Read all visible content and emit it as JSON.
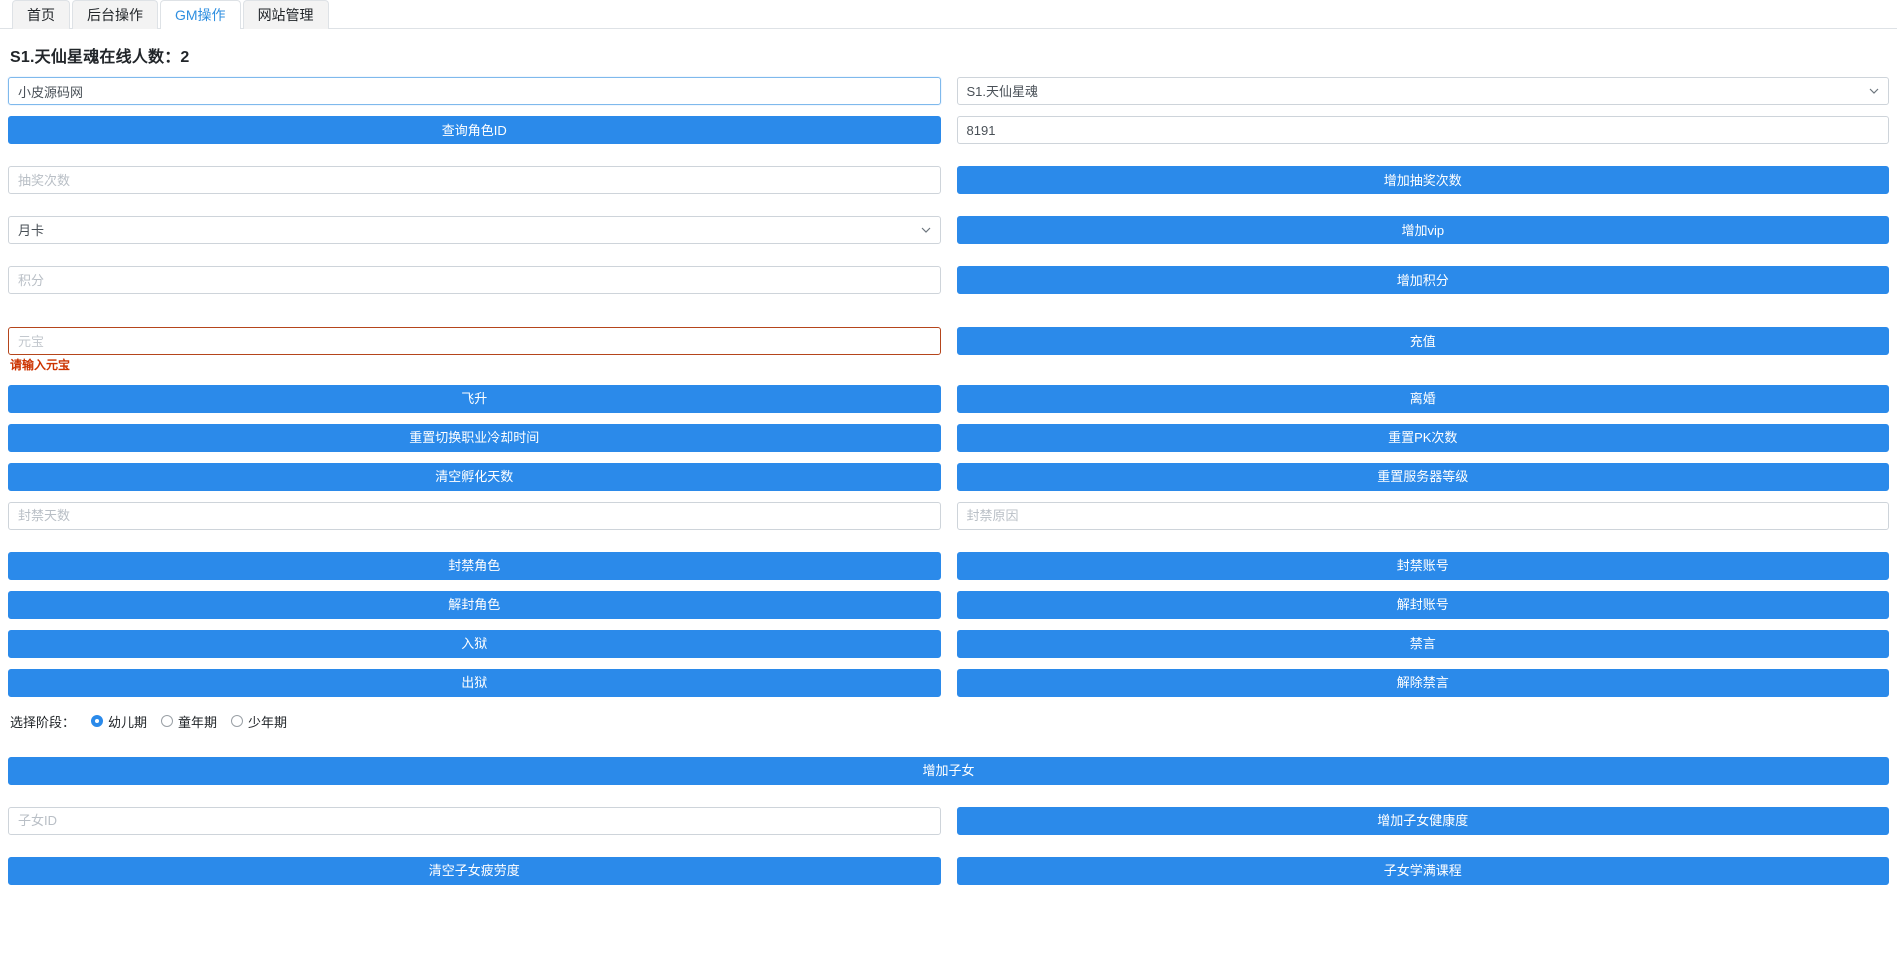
{
  "tabs": [
    {
      "label": "首页",
      "active": false
    },
    {
      "label": "后台操作",
      "active": false
    },
    {
      "label": "GM操作",
      "active": true
    },
    {
      "label": "网站管理",
      "active": false
    }
  ],
  "page_title": "S1.天仙星魂在线人数：2",
  "form": {
    "account_input": {
      "value": "小皮源码网",
      "placeholder": ""
    },
    "server_select": {
      "value": "S1.天仙星魂",
      "icon": "chevron-down-icon"
    },
    "query_role_id_button": "查询角色ID",
    "role_id_input": {
      "value": "8191",
      "placeholder": ""
    },
    "lottery_count_input": {
      "value": "",
      "placeholder": "抽奖次数"
    },
    "add_lottery_count_button": "增加抽奖次数",
    "vip_select": {
      "value": "月卡",
      "icon": "chevron-down-icon"
    },
    "add_vip_button": "增加vip",
    "points_input": {
      "value": "",
      "placeholder": "积分"
    },
    "add_points_button": "增加积分",
    "ingot_input": {
      "value": "",
      "placeholder": "元宝"
    },
    "ingot_error": "请输入元宝",
    "recharge_button": "充值",
    "ascend_button": "飞升",
    "divorce_button": "离婚",
    "reset_job_cooldown_button": "重置切换职业冷却时间",
    "reset_pk_count_button": "重置PK次数",
    "clear_incubation_days_button": "清空孵化天数",
    "reset_server_level_button": "重置服务器等级",
    "ban_days_input": {
      "value": "",
      "placeholder": "封禁天数"
    },
    "ban_reason_input": {
      "value": "",
      "placeholder": "封禁原因"
    },
    "ban_role_button": "封禁角色",
    "ban_account_button": "封禁账号",
    "unban_role_button": "解封角色",
    "unban_account_button": "解封账号",
    "jail_button": "入狱",
    "mute_button": "禁言",
    "release_button": "出狱",
    "unmute_button": "解除禁言",
    "stage_label": "选择阶段：",
    "stage_options": [
      {
        "label": "幼儿期",
        "checked": true
      },
      {
        "label": "童年期",
        "checked": false
      },
      {
        "label": "少年期",
        "checked": false
      }
    ],
    "add_child_button": "增加子女",
    "child_id_input": {
      "value": "",
      "placeholder": "子女ID"
    },
    "add_child_health_button": "增加子女健康度",
    "clear_child_fatigue_button": "清空子女疲劳度",
    "child_full_course_button": "子女学满课程"
  },
  "colors": {
    "primary": "#2b8aea",
    "tab_active_text": "#2f8fe0",
    "error": "#cc3300",
    "invalid_border": "#b5451b"
  }
}
